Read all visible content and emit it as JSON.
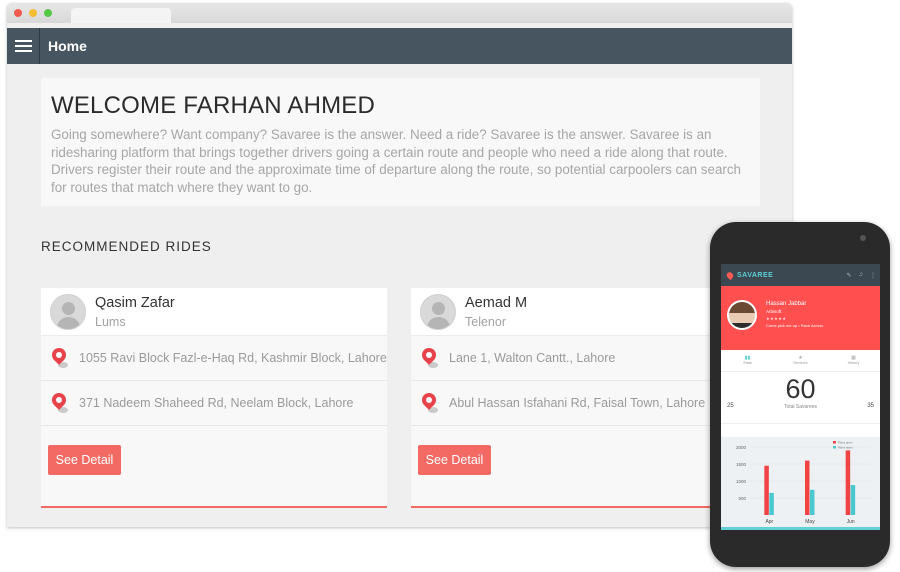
{
  "app": {
    "title": "Home",
    "welcome_title": "WELCOME FARHAN AHMED",
    "welcome_text": "Going somewhere? Want company? Savaree is the answer. Need a ride? Savaree is the answer. Savaree is an ridesharing platform that brings together drivers going a certain route and people who need a ride along that route. Drivers register their route and the approximate time of departure along the route, so potential carpoolers can search for routes that match where they want to go.",
    "section_title": "RECOMMENDED RIDES"
  },
  "rides": [
    {
      "name": "Qasim Zafar",
      "org": "Lums",
      "from": "1055 Ravi Block Fazl-e-Haq Rd, Kashmir Block, Lahore",
      "to": "371 Nadeem Shaheed Rd, Neelam Block, Lahore",
      "button": "See Detail"
    },
    {
      "name": "Aemad M",
      "org": "Telenor",
      "from": "Lane 1, Walton Cantt., Lahore",
      "to": "Abul Hassan Isfahani Rd, Faisal Town, Lahore",
      "button": "See Detail"
    }
  ],
  "phone": {
    "brand": "SAVAREE",
    "profile_name": "Hassan Jabbar",
    "profile_sub": "Arbisoft",
    "profile_route": "Come pick me up • Race Across",
    "tabs": [
      "Stats",
      "Reviews",
      "History"
    ],
    "total": "60",
    "total_label": "Total Savarees",
    "left_count": "25",
    "right_count": "35"
  },
  "chart_data": {
    "type": "bar",
    "categories": [
      "Apr",
      "May",
      "Jun"
    ],
    "yticks": [
      "2000",
      "1500",
      "1000",
      "500"
    ],
    "legend": [
      "Rides given",
      "Rides taken"
    ],
    "series": [
      {
        "name": "Rides given",
        "values": [
          1450,
          1600,
          1900
        ]
      },
      {
        "name": "Rides taken",
        "values": [
          650,
          740,
          880
        ]
      }
    ],
    "ylim": [
      0,
      2000
    ],
    "colors": [
      "#f04444",
      "#4ac8cf"
    ]
  },
  "colors": {
    "accent": "#f26a63",
    "appbar": "#465560",
    "phone_header": "#ff4f4f"
  }
}
